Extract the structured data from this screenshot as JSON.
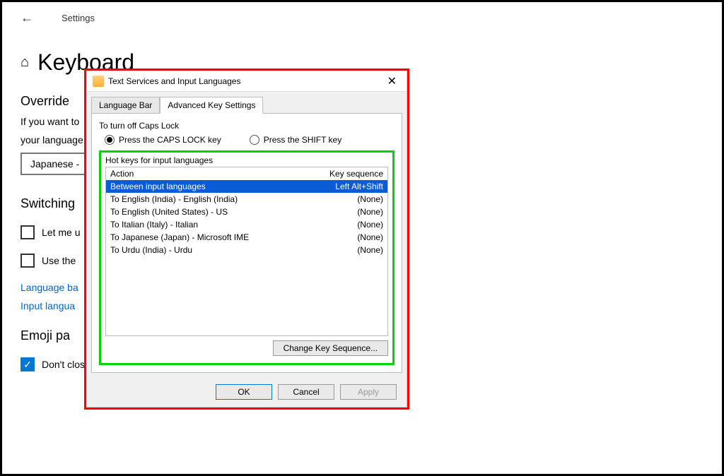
{
  "header": {
    "settings_label": "Settings",
    "page_title": "Keyboard"
  },
  "override": {
    "heading_partial": "Override",
    "body_line1": "If you want to",
    "body_line2": "your language",
    "dropdown_value": "Japanese -"
  },
  "switching": {
    "heading_partial": "Switching",
    "checkbox1_partial": "Let me u",
    "checkbox2_partial": "Use the",
    "link1_partial": "Language ba",
    "link2_partial": "Input langua"
  },
  "emoji": {
    "heading_partial": "Emoji pa",
    "checkbox_label": "Don't close the panel automatically after an emoji has been entered"
  },
  "dialog": {
    "title": "Text Services and Input Languages",
    "tabs": {
      "lang_bar": "Language Bar",
      "advanced": "Advanced Key Settings"
    },
    "caps": {
      "group_label": "To turn off Caps Lock",
      "press_caps": "Press the CAPS LOCK key",
      "press_shift": "Press the SHIFT key"
    },
    "hotkeys": {
      "group_label": "Hot keys for input languages",
      "header_action": "Action",
      "header_seq": "Key sequence",
      "rows": [
        {
          "action": "Between input languages",
          "seq": "Left Alt+Shift",
          "selected": true
        },
        {
          "action": "To English (India) - English (India)",
          "seq": "(None)",
          "selected": false
        },
        {
          "action": "To English (United States) - US",
          "seq": "(None)",
          "selected": false
        },
        {
          "action": "To Italian (Italy) - Italian",
          "seq": "(None)",
          "selected": false
        },
        {
          "action": "To Japanese (Japan) - Microsoft IME",
          "seq": "(None)",
          "selected": false
        },
        {
          "action": "To Urdu (India) - Urdu",
          "seq": "(None)",
          "selected": false
        }
      ],
      "change_btn": "Change Key Sequence..."
    },
    "buttons": {
      "ok": "OK",
      "cancel": "Cancel",
      "apply": "Apply"
    }
  }
}
